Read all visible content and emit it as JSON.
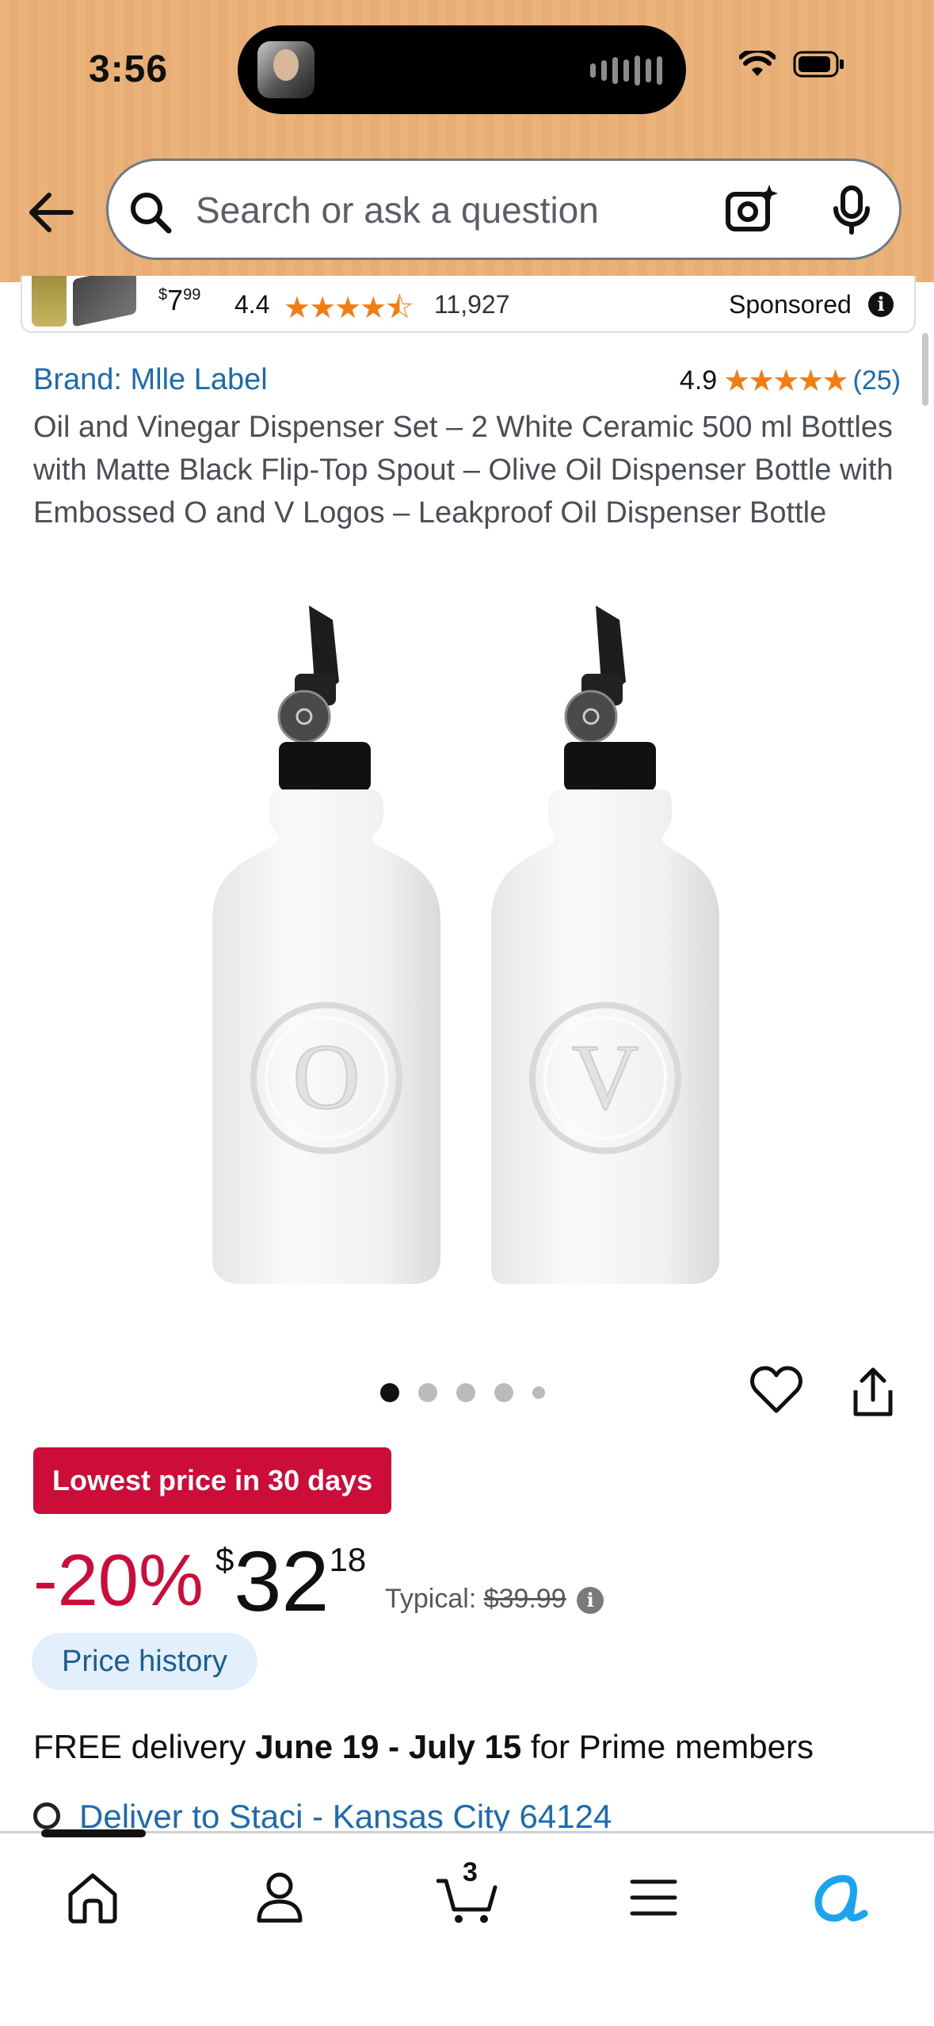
{
  "status_bar": {
    "time": "3:56"
  },
  "search": {
    "placeholder": "Search or ask a question"
  },
  "sponsored": {
    "price_symbol": "$",
    "price_whole": "7",
    "price_fraction": "99",
    "rating": "4.4",
    "review_count": "11,927",
    "label": "Sponsored",
    "info_glyph": "i"
  },
  "product": {
    "brand": "Brand: Mlle Label",
    "rating": "4.9",
    "rating_count": "(25)",
    "title": "Oil and Vinegar Dispenser Set – 2 White Ceramic 500 ml Bottles with Matte Black Flip-Top Spout – Olive Oil Dispenser Bottle with Embossed O and V Logos – Leakproof Oil Dispenser Bottle",
    "image_logos": [
      "O",
      "V"
    ],
    "image_count": 5,
    "active_image": 1
  },
  "pricing": {
    "badge": "Lowest price in 30 days",
    "discount": "-20%",
    "currency": "$",
    "whole": "32",
    "fraction": "18",
    "typical_label": "Typical:",
    "typical_price": "$39.99",
    "info_glyph": "i",
    "price_history": "Price history"
  },
  "delivery": {
    "prefix": "FREE delivery ",
    "dates": "June 19 - July 15",
    "suffix": " for Prime members",
    "deliver_to": "Deliver to Staci - Kansas City 64124"
  },
  "bottom_nav": {
    "cart_count": "3"
  },
  "colors": {
    "header_bg": "#eab37c",
    "link_blue": "#1c6bb0",
    "deal_red": "#cc0c39",
    "star_orange": "#f27d12",
    "alexa_blue": "#1aa4f0"
  },
  "icons": [
    "back-arrow-icon",
    "search-icon",
    "camera-icon",
    "mic-icon",
    "heart-icon",
    "share-icon",
    "home-icon",
    "account-icon",
    "cart-icon",
    "menu-icon",
    "alexa-icon"
  ]
}
